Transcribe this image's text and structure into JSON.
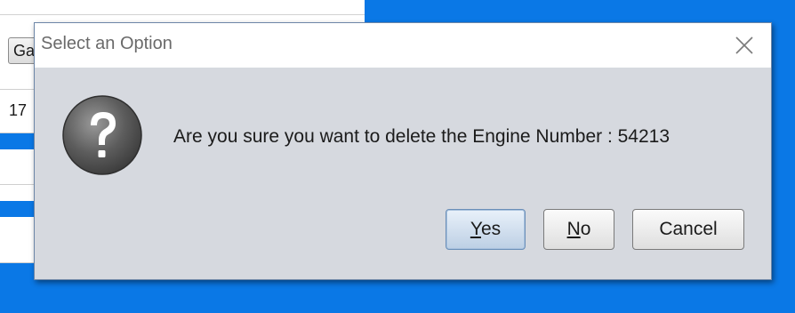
{
  "background": {
    "button_label": "Ga",
    "field_value": "17"
  },
  "dialog": {
    "title": "Select an Option",
    "close_icon": "close-icon",
    "icon": "question-icon",
    "message": "Are you sure you want to delete the Engine Number : 54213",
    "buttons": {
      "yes": {
        "mnemonic": "Y",
        "rest": "es"
      },
      "no": {
        "mnemonic": "N",
        "rest": "o"
      },
      "cancel": {
        "label": "Cancel"
      }
    }
  },
  "colors": {
    "dialog_background": "#d6d9df",
    "titlebar_background": "#ffffff",
    "desktop_accent": "#0a78e6",
    "default_button": "#bccfe4"
  }
}
